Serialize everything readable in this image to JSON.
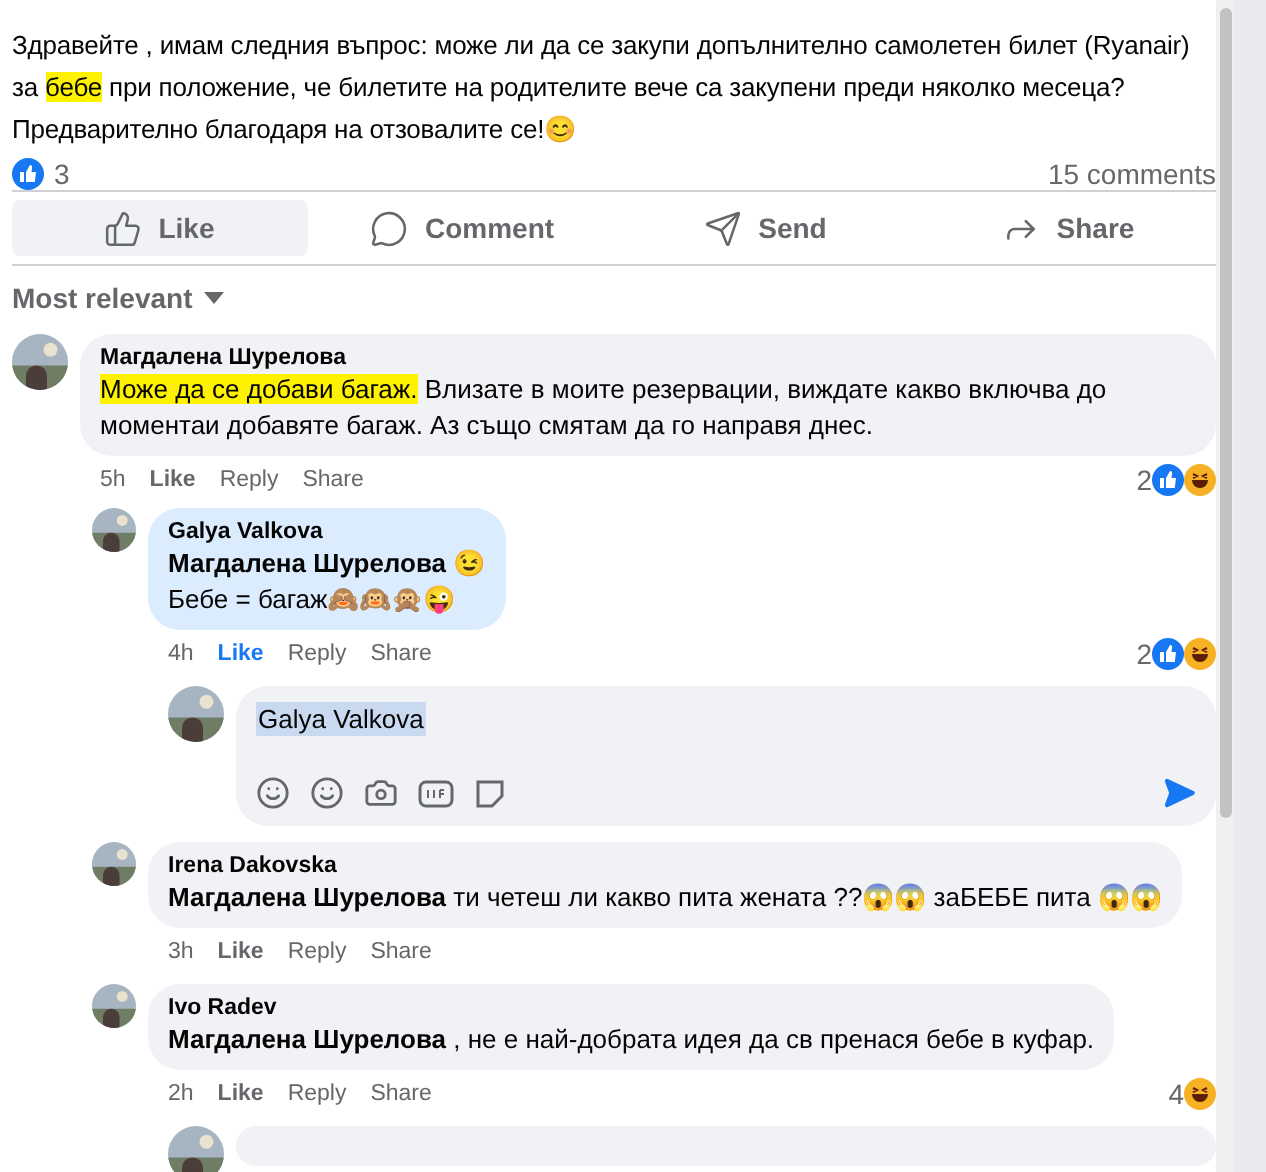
{
  "post": {
    "text": [
      {
        "text": "Здравейте , имам следния въпрос: може ли да се закупи допълнително самолетен билет (Ryanair) за ",
        "highlighted": false
      },
      {
        "text": "бебе",
        "highlighted": true
      },
      {
        "text": " при положение, че билетите на родителите вече са закупени преди няколко месеца? Предварително благодаря на отзовалите се!😊",
        "highlighted": false
      }
    ],
    "reaction_count": "3",
    "comments_count": "15 comments"
  },
  "actions": [
    {
      "kind": "like",
      "label": "Like",
      "selected": true
    },
    {
      "kind": "comment",
      "label": "Comment",
      "selected": false
    },
    {
      "kind": "send",
      "label": "Send",
      "selected": false
    },
    {
      "kind": "share",
      "label": "Share",
      "selected": false
    }
  ],
  "sort": {
    "label": "Most relevant"
  },
  "comments": [
    {
      "kind": "comment",
      "author": "Магдалена Шурелова",
      "text": [
        {
          "text": "Може да се добави багаж.",
          "highlighted": true
        },
        {
          "text": " Влизате в моите резервации, виждате какво включва до моментаи добавяте багаж. Аз също смятам да го направя днес.",
          "highlighted": false
        }
      ],
      "time": "5h",
      "liked": false,
      "highlighted": false,
      "actions": [
        "Like",
        "Reply",
        "Share"
      ],
      "reaction_count": "2",
      "reactions": [
        {
          "kind": "like"
        },
        {
          "kind": "haha"
        }
      ],
      "children": [
        {
          "kind": "comment",
          "author": "Galya Valkova",
          "lines": [
            "**Магдалена Шурелова** 😉",
            "Бебе = багаж🙈🙉🙊😜"
          ],
          "time": "4h",
          "liked": true,
          "highlighted": true,
          "actions": [
            "Like",
            "Reply",
            "Share"
          ],
          "reaction_count": "2",
          "reactions": [
            {
              "kind": "like"
            },
            {
              "kind": "haha"
            }
          ]
        },
        {
          "kind": "reply_box",
          "value": "Galya Valkova"
        },
        {
          "kind": "comment",
          "author": "Irena Dakovska",
          "lines": [
            "**Магдалена Шурелова** ти четеш ли какво пита жената ??😱😱 заБЕБЕ пита 😱😱"
          ],
          "time": "3h",
          "liked": false,
          "highlighted": false,
          "actions": [
            "Like",
            "Reply",
            "Share"
          ]
        },
        {
          "kind": "comment",
          "author": "Ivo Radev",
          "lines": [
            "**Магдалена Шурелова** , не е най-добрата идея да св пренася бебе в куфар."
          ],
          "time": "2h",
          "liked": false,
          "highlighted": false,
          "actions": [
            "Like",
            "Reply",
            "Share"
          ],
          "reaction_count": "4",
          "reactions": [
            {
              "kind": "haha"
            }
          ]
        },
        {
          "kind": "reply_box"
        }
      ]
    }
  ]
}
